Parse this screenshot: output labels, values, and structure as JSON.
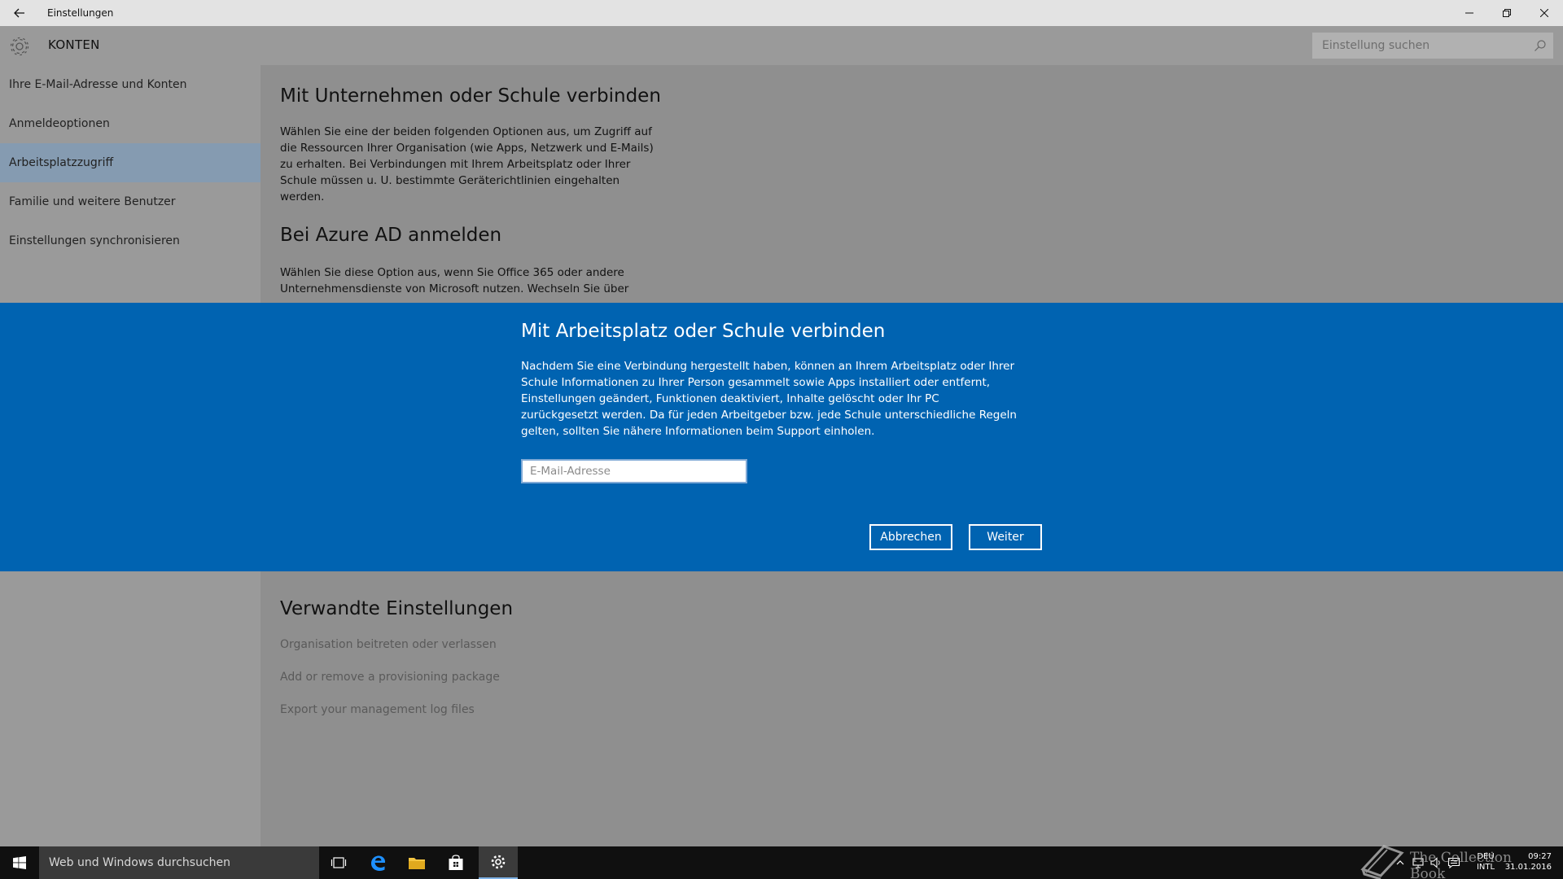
{
  "titlebar": {
    "title": "Einstellungen"
  },
  "header": {
    "section": "KONTEN",
    "search_placeholder": "Einstellung suchen"
  },
  "sidebar": {
    "items": [
      {
        "label": "Ihre E-Mail-Adresse und Konten"
      },
      {
        "label": "Anmeldeoptionen"
      },
      {
        "label": "Arbeitsplatzzugriff"
      },
      {
        "label": "Familie und weitere Benutzer"
      },
      {
        "label": "Einstellungen synchronisieren"
      }
    ],
    "active_index": 2
  },
  "main": {
    "heading1": "Mit Unternehmen oder Schule verbinden",
    "para1": "Wählen Sie eine der beiden folgenden Optionen aus, um Zugriff auf die Ressourcen Ihrer Organisation (wie Apps, Netzwerk und E-Mails) zu erhalten. Bei Verbindungen mit Ihrem Arbeitsplatz oder Ihrer Schule müssen u. U. bestimmte Geräterichtlinien eingehalten werden.",
    "heading2": "Bei Azure AD anmelden",
    "para2": "Wählen Sie diese Option aus, wenn Sie Office 365 oder andere Unternehmensdienste von Microsoft nutzen. Wechseln Sie über",
    "related_heading": "Verwandte Einstellungen",
    "related_links": [
      {
        "label": "Organisation beitreten oder verlassen"
      },
      {
        "label": "Add or remove a provisioning package"
      },
      {
        "label": "Export your management log files"
      }
    ]
  },
  "dialog": {
    "title": "Mit Arbeitsplatz oder Schule verbinden",
    "message": "Nachdem Sie eine Verbindung hergestellt haben, können an Ihrem Arbeitsplatz oder Ihrer Schule Informationen zu Ihrer Person gesammelt sowie Apps installiert oder entfernt, Einstellungen geändert, Funktionen deaktiviert, Inhalte gelöscht oder Ihr PC zurückgesetzt werden. Da für jeden Arbeitgeber bzw. jede Schule unterschiedliche Regeln gelten, sollten Sie nähere Informationen beim Support einholen.",
    "email_placeholder": "E-Mail-Adresse",
    "email_value": "",
    "cancel_label": "Abbrechen",
    "next_label": "Weiter"
  },
  "taskbar": {
    "search_placeholder": "Web und Windows durchsuchen",
    "lang_line1": "DEU",
    "lang_line2": "INTL",
    "time": "09:27",
    "date": "31.01.2016"
  },
  "watermark": "The Collection Book",
  "colors": {
    "accent": "#0063b1",
    "sidebar_active": "#859bb1",
    "taskbar": "#101010"
  }
}
